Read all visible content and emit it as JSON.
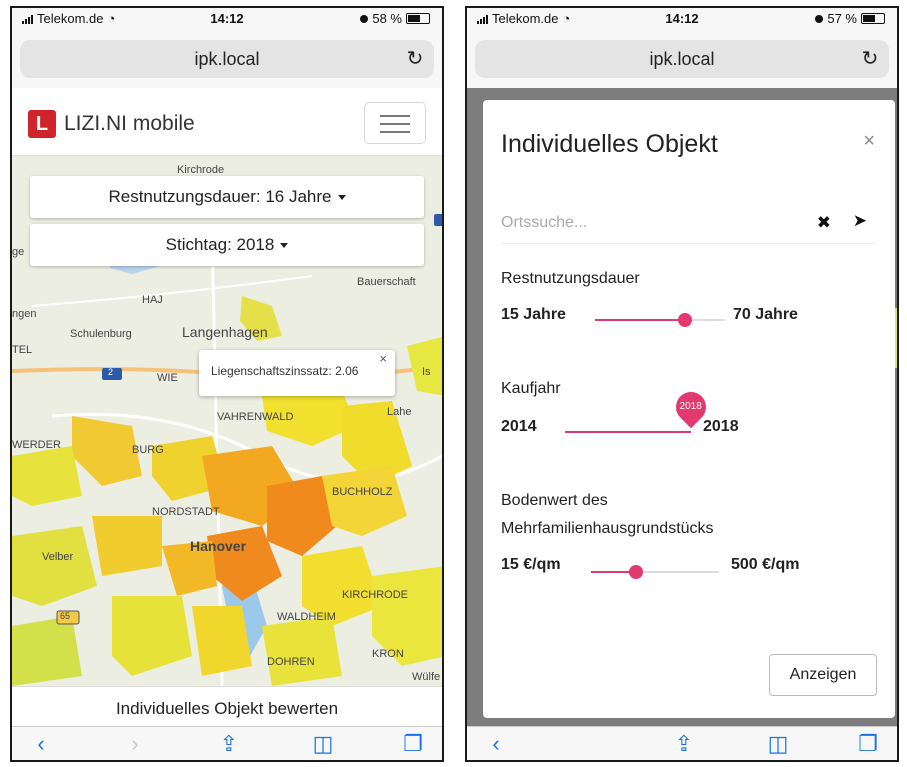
{
  "colors": {
    "accent": "#e23a6e",
    "brand": "#d0242c",
    "ios_blue": "#1a73e8"
  },
  "left": {
    "status": {
      "carrier": "Telekom.de",
      "time": "14:12",
      "battery": "58 %",
      "battery_level": 0.58
    },
    "url": "ipk.local",
    "app": {
      "logo_letter": "L",
      "brand": "LIZI.NI mobile"
    },
    "selectors": {
      "duration": "Restnutzungsdauer: 16 Jahre",
      "date": "Stichtag: 2018"
    },
    "map_labels": {
      "kirchrode_top": "Kirchrode",
      "bauerschaft": "Bauerschaft",
      "haj": "HAJ",
      "ngen": "ngen",
      "schulenburg": "Schulenburg",
      "langenhagen": "Langenhagen",
      "tel": "TEL",
      "route2": "2",
      "wie": "WIE",
      "vahrenwald": "VAHRENWALD",
      "lahe": "Lahe",
      "werder": "WERDER",
      "burg": "BURG",
      "buchholz": "BUCHHOLZ",
      "nordstadt": "NORDSTADT",
      "hanover": "Hanover",
      "velber": "Velber",
      "kirchrode": "KIRCHRODE",
      "route65": "65",
      "waldheim": "WALDHEIM",
      "dohren": "DOHREN",
      "kron": "KRON",
      "wulfe": "Wülfe",
      "ge": "ge",
      "is": "Is"
    },
    "popup": {
      "text": "Liegenschaftszinssatz: 2.06",
      "close": "×"
    },
    "evaluate_button": "Individuelles Objekt bewerten",
    "toolbar": {
      "back": "‹",
      "forward": "›"
    }
  },
  "right": {
    "status": {
      "carrier": "Telekom.de",
      "time": "14:12",
      "battery": "57 %",
      "battery_level": 0.57
    },
    "url": "ipk.local",
    "modal": {
      "title": "Individuelles Objekt",
      "close": "×",
      "search_placeholder": "Ortssuche...",
      "search_clear": "✖",
      "restnutzung": {
        "label": "Restnutzungsdauer",
        "min": "15 Jahre",
        "max": "70 Jahre",
        "value_fraction": 0.69
      },
      "kaufjahr": {
        "label": "Kaufjahr",
        "min": "2014",
        "max": "2018",
        "pin": "2018",
        "value_fraction": 1.0
      },
      "bodenwert": {
        "label_line1": "Bodenwert des",
        "label_line2": "Mehrfamilienhausgrundstücks",
        "min": "15 €/qm",
        "max": "500 €/qm",
        "value_fraction": 0.35
      },
      "show_button": "Anzeigen"
    },
    "toolbar": {
      "back": "‹"
    }
  }
}
